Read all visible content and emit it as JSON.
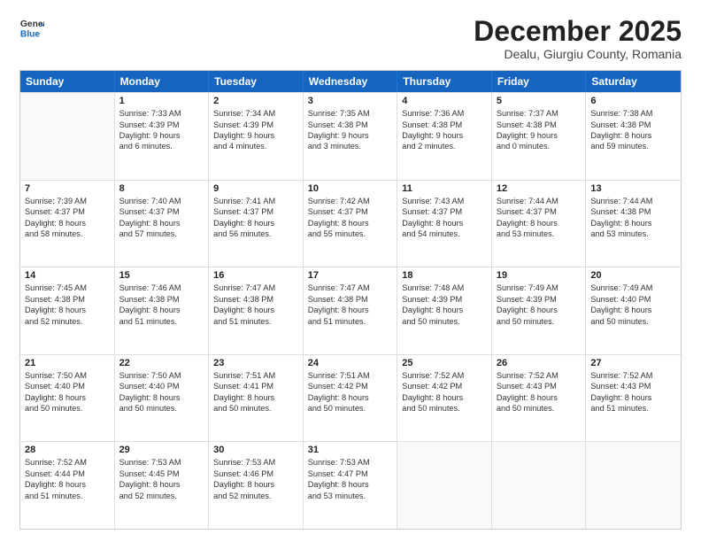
{
  "header": {
    "logo_general": "General",
    "logo_blue": "Blue",
    "month_title": "December 2025",
    "location": "Dealu, Giurgiu County, Romania"
  },
  "days_of_week": [
    "Sunday",
    "Monday",
    "Tuesday",
    "Wednesday",
    "Thursday",
    "Friday",
    "Saturday"
  ],
  "weeks": [
    [
      {
        "day": "",
        "lines": []
      },
      {
        "day": "1",
        "lines": [
          "Sunrise: 7:33 AM",
          "Sunset: 4:39 PM",
          "Daylight: 9 hours",
          "and 6 minutes."
        ]
      },
      {
        "day": "2",
        "lines": [
          "Sunrise: 7:34 AM",
          "Sunset: 4:39 PM",
          "Daylight: 9 hours",
          "and 4 minutes."
        ]
      },
      {
        "day": "3",
        "lines": [
          "Sunrise: 7:35 AM",
          "Sunset: 4:38 PM",
          "Daylight: 9 hours",
          "and 3 minutes."
        ]
      },
      {
        "day": "4",
        "lines": [
          "Sunrise: 7:36 AM",
          "Sunset: 4:38 PM",
          "Daylight: 9 hours",
          "and 2 minutes."
        ]
      },
      {
        "day": "5",
        "lines": [
          "Sunrise: 7:37 AM",
          "Sunset: 4:38 PM",
          "Daylight: 9 hours",
          "and 0 minutes."
        ]
      },
      {
        "day": "6",
        "lines": [
          "Sunrise: 7:38 AM",
          "Sunset: 4:38 PM",
          "Daylight: 8 hours",
          "and 59 minutes."
        ]
      }
    ],
    [
      {
        "day": "7",
        "lines": [
          "Sunrise: 7:39 AM",
          "Sunset: 4:37 PM",
          "Daylight: 8 hours",
          "and 58 minutes."
        ]
      },
      {
        "day": "8",
        "lines": [
          "Sunrise: 7:40 AM",
          "Sunset: 4:37 PM",
          "Daylight: 8 hours",
          "and 57 minutes."
        ]
      },
      {
        "day": "9",
        "lines": [
          "Sunrise: 7:41 AM",
          "Sunset: 4:37 PM",
          "Daylight: 8 hours",
          "and 56 minutes."
        ]
      },
      {
        "day": "10",
        "lines": [
          "Sunrise: 7:42 AM",
          "Sunset: 4:37 PM",
          "Daylight: 8 hours",
          "and 55 minutes."
        ]
      },
      {
        "day": "11",
        "lines": [
          "Sunrise: 7:43 AM",
          "Sunset: 4:37 PM",
          "Daylight: 8 hours",
          "and 54 minutes."
        ]
      },
      {
        "day": "12",
        "lines": [
          "Sunrise: 7:44 AM",
          "Sunset: 4:37 PM",
          "Daylight: 8 hours",
          "and 53 minutes."
        ]
      },
      {
        "day": "13",
        "lines": [
          "Sunrise: 7:44 AM",
          "Sunset: 4:38 PM",
          "Daylight: 8 hours",
          "and 53 minutes."
        ]
      }
    ],
    [
      {
        "day": "14",
        "lines": [
          "Sunrise: 7:45 AM",
          "Sunset: 4:38 PM",
          "Daylight: 8 hours",
          "and 52 minutes."
        ]
      },
      {
        "day": "15",
        "lines": [
          "Sunrise: 7:46 AM",
          "Sunset: 4:38 PM",
          "Daylight: 8 hours",
          "and 51 minutes."
        ]
      },
      {
        "day": "16",
        "lines": [
          "Sunrise: 7:47 AM",
          "Sunset: 4:38 PM",
          "Daylight: 8 hours",
          "and 51 minutes."
        ]
      },
      {
        "day": "17",
        "lines": [
          "Sunrise: 7:47 AM",
          "Sunset: 4:38 PM",
          "Daylight: 8 hours",
          "and 51 minutes."
        ]
      },
      {
        "day": "18",
        "lines": [
          "Sunrise: 7:48 AM",
          "Sunset: 4:39 PM",
          "Daylight: 8 hours",
          "and 50 minutes."
        ]
      },
      {
        "day": "19",
        "lines": [
          "Sunrise: 7:49 AM",
          "Sunset: 4:39 PM",
          "Daylight: 8 hours",
          "and 50 minutes."
        ]
      },
      {
        "day": "20",
        "lines": [
          "Sunrise: 7:49 AM",
          "Sunset: 4:40 PM",
          "Daylight: 8 hours",
          "and 50 minutes."
        ]
      }
    ],
    [
      {
        "day": "21",
        "lines": [
          "Sunrise: 7:50 AM",
          "Sunset: 4:40 PM",
          "Daylight: 8 hours",
          "and 50 minutes."
        ]
      },
      {
        "day": "22",
        "lines": [
          "Sunrise: 7:50 AM",
          "Sunset: 4:40 PM",
          "Daylight: 8 hours",
          "and 50 minutes."
        ]
      },
      {
        "day": "23",
        "lines": [
          "Sunrise: 7:51 AM",
          "Sunset: 4:41 PM",
          "Daylight: 8 hours",
          "and 50 minutes."
        ]
      },
      {
        "day": "24",
        "lines": [
          "Sunrise: 7:51 AM",
          "Sunset: 4:42 PM",
          "Daylight: 8 hours",
          "and 50 minutes."
        ]
      },
      {
        "day": "25",
        "lines": [
          "Sunrise: 7:52 AM",
          "Sunset: 4:42 PM",
          "Daylight: 8 hours",
          "and 50 minutes."
        ]
      },
      {
        "day": "26",
        "lines": [
          "Sunrise: 7:52 AM",
          "Sunset: 4:43 PM",
          "Daylight: 8 hours",
          "and 50 minutes."
        ]
      },
      {
        "day": "27",
        "lines": [
          "Sunrise: 7:52 AM",
          "Sunset: 4:43 PM",
          "Daylight: 8 hours",
          "and 51 minutes."
        ]
      }
    ],
    [
      {
        "day": "28",
        "lines": [
          "Sunrise: 7:52 AM",
          "Sunset: 4:44 PM",
          "Daylight: 8 hours",
          "and 51 minutes."
        ]
      },
      {
        "day": "29",
        "lines": [
          "Sunrise: 7:53 AM",
          "Sunset: 4:45 PM",
          "Daylight: 8 hours",
          "and 52 minutes."
        ]
      },
      {
        "day": "30",
        "lines": [
          "Sunrise: 7:53 AM",
          "Sunset: 4:46 PM",
          "Daylight: 8 hours",
          "and 52 minutes."
        ]
      },
      {
        "day": "31",
        "lines": [
          "Sunrise: 7:53 AM",
          "Sunset: 4:47 PM",
          "Daylight: 8 hours",
          "and 53 minutes."
        ]
      },
      {
        "day": "",
        "lines": []
      },
      {
        "day": "",
        "lines": []
      },
      {
        "day": "",
        "lines": []
      }
    ]
  ]
}
